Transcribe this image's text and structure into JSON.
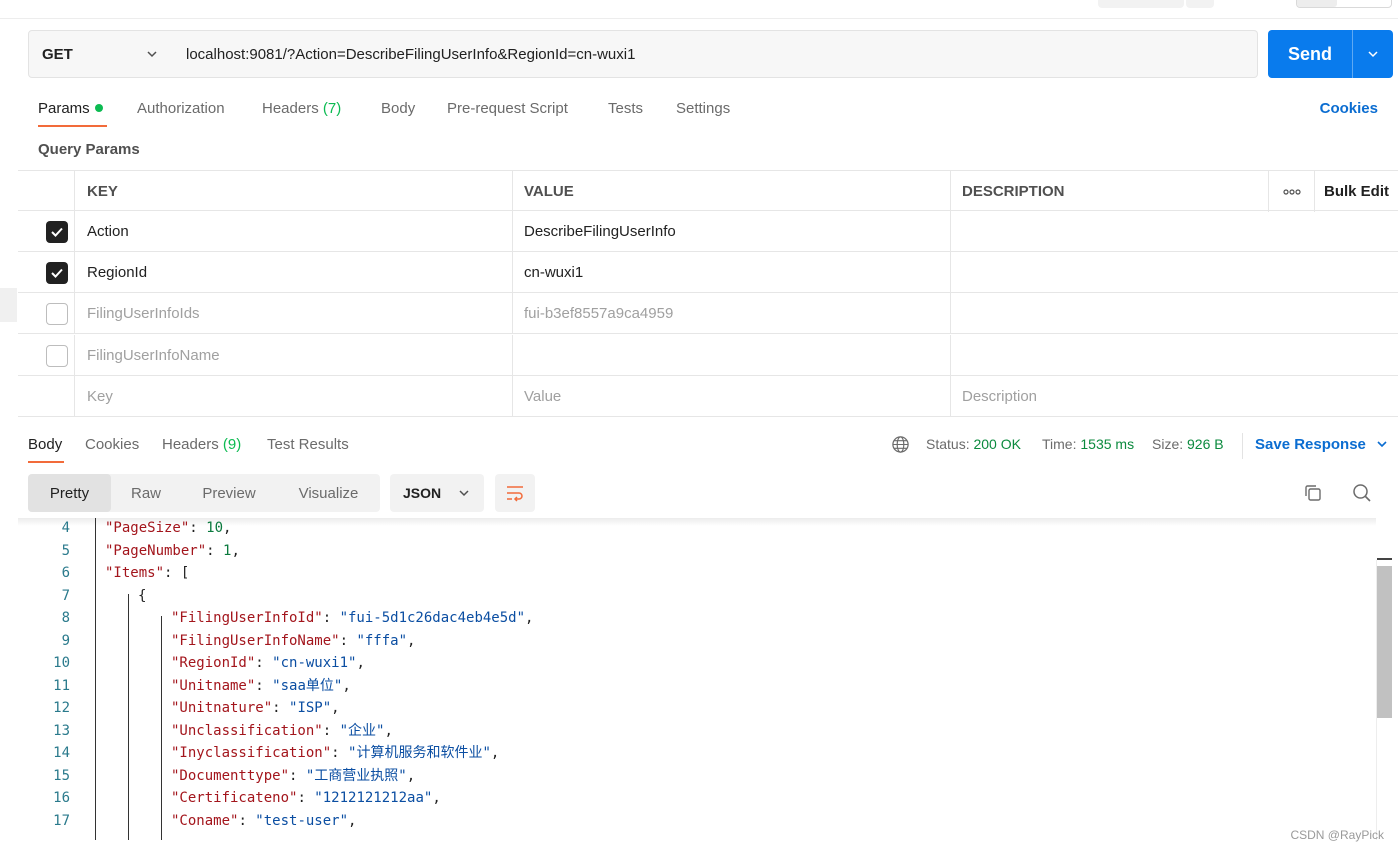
{
  "request": {
    "method": "GET",
    "url": "localhost:9081/?Action=DescribeFilingUserInfo&RegionId=cn-wuxi1",
    "send_label": "Send"
  },
  "request_tabs": {
    "params": "Params",
    "authorization": "Authorization",
    "headers": "Headers",
    "headers_count": "(7)",
    "body": "Body",
    "prerequest": "Pre-request Script",
    "tests": "Tests",
    "settings": "Settings",
    "cookies": "Cookies"
  },
  "query_params": {
    "title": "Query Params",
    "headers": {
      "key": "KEY",
      "value": "VALUE",
      "description": "DESCRIPTION",
      "more": "∘∘∘",
      "bulk_edit": "Bulk Edit"
    },
    "rows": [
      {
        "checked": true,
        "key": "Action",
        "value": "DescribeFilingUserInfo",
        "description": ""
      },
      {
        "checked": true,
        "key": "RegionId",
        "value": "cn-wuxi1",
        "description": ""
      },
      {
        "checked": false,
        "key": "FilingUserInfoIds",
        "value": "fui-b3ef8557a9ca4959",
        "description": ""
      },
      {
        "checked": false,
        "key": "FilingUserInfoName",
        "value": "",
        "description": ""
      }
    ],
    "placeholder": {
      "key": "Key",
      "value": "Value",
      "description": "Description"
    }
  },
  "response": {
    "tabs": {
      "body": "Body",
      "cookies": "Cookies",
      "headers": "Headers",
      "headers_count": "(9)",
      "test_results": "Test Results"
    },
    "status_label": "Status:",
    "status_value": "200 OK",
    "time_label": "Time:",
    "time_value": "1535 ms",
    "size_label": "Size:",
    "size_value": "926 B",
    "save_response": "Save Response",
    "views": {
      "pretty": "Pretty",
      "raw": "Raw",
      "preview": "Preview",
      "visualize": "Visualize"
    },
    "format": "JSON",
    "code_lines": [
      {
        "n": "4",
        "indent": 1,
        "key": "\"PageSize\"",
        "val": "10",
        "type": "num",
        "tail": ","
      },
      {
        "n": "5",
        "indent": 1,
        "key": "\"PageNumber\"",
        "val": "1",
        "type": "num",
        "tail": ","
      },
      {
        "n": "6",
        "indent": 1,
        "key": "\"Items\"",
        "val": "[",
        "type": "punct",
        "tail": ""
      },
      {
        "n": "7",
        "indent": 2,
        "key": "",
        "val": "{",
        "type": "punct",
        "tail": ""
      },
      {
        "n": "8",
        "indent": 3,
        "key": "\"FilingUserInfoId\"",
        "val": "\"fui-5d1c26dac4eb4e5d\"",
        "type": "str",
        "tail": ","
      },
      {
        "n": "9",
        "indent": 3,
        "key": "\"FilingUserInfoName\"",
        "val": "\"fffa\"",
        "type": "str",
        "tail": ","
      },
      {
        "n": "10",
        "indent": 3,
        "key": "\"RegionId\"",
        "val": "\"cn-wuxi1\"",
        "type": "str",
        "tail": ","
      },
      {
        "n": "11",
        "indent": 3,
        "key": "\"Unitname\"",
        "val": "\"saa单位\"",
        "type": "str",
        "tail": ","
      },
      {
        "n": "12",
        "indent": 3,
        "key": "\"Unitnature\"",
        "val": "\"ISP\"",
        "type": "str",
        "tail": ","
      },
      {
        "n": "13",
        "indent": 3,
        "key": "\"Unclassification\"",
        "val": "\"企业\"",
        "type": "str",
        "tail": ","
      },
      {
        "n": "14",
        "indent": 3,
        "key": "\"Inyclassification\"",
        "val": "\"计算机服务和软件业\"",
        "type": "str",
        "tail": ","
      },
      {
        "n": "15",
        "indent": 3,
        "key": "\"Documenttype\"",
        "val": "\"工商营业执照\"",
        "type": "str",
        "tail": ","
      },
      {
        "n": "16",
        "indent": 3,
        "key": "\"Certificateno\"",
        "val": "\"1212121212aa\"",
        "type": "str",
        "tail": ","
      },
      {
        "n": "17",
        "indent": 3,
        "key": "\"Coname\"",
        "val": "\"test-user\"",
        "type": "str",
        "tail": ","
      }
    ]
  },
  "watermark": "CSDN @RayPick",
  "colors": {
    "accent": "#097bed",
    "tab_underline": "#f26b3a",
    "success": "#0cbb52"
  }
}
